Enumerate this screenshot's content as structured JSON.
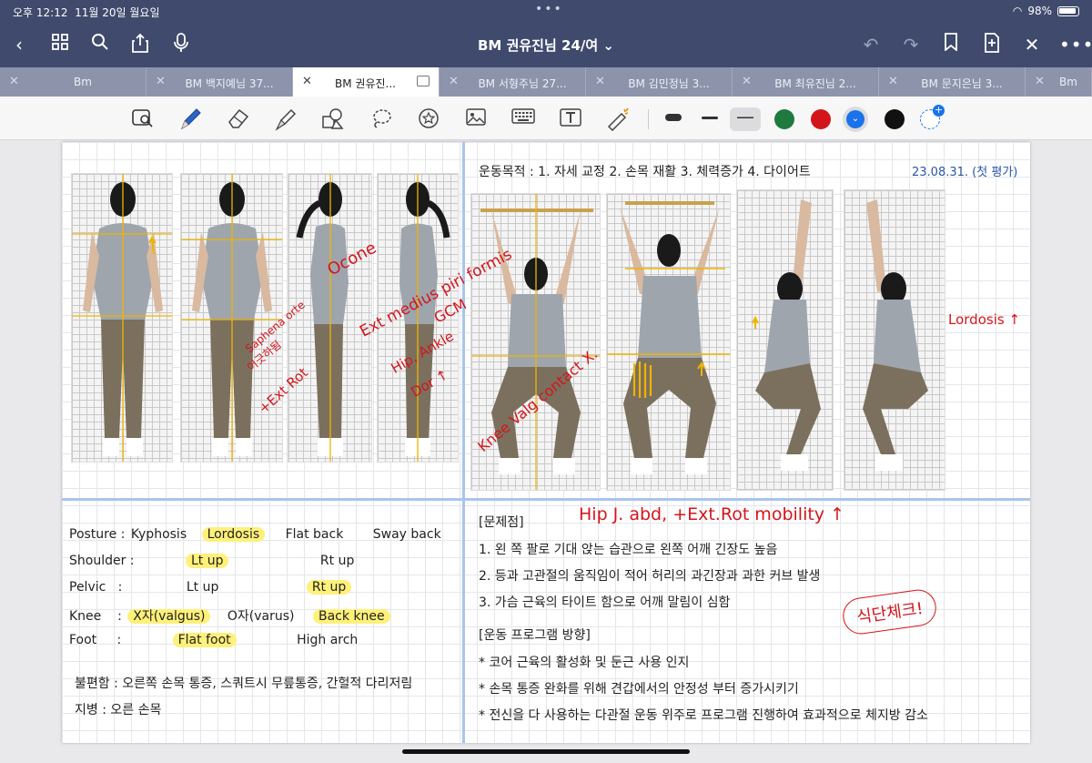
{
  "status_bar": {
    "time": "오후 12:12",
    "date": "11월 20일 월요일",
    "wifi_icon": "wifi-icon",
    "battery": "98%"
  },
  "nav": {
    "title": "BM 권유진님 24/여",
    "chevron": "⌄",
    "icons": [
      "back-icon",
      "grid-icon",
      "search-icon",
      "share-icon",
      "mic-icon",
      "undo-icon",
      "redo-icon",
      "bookmark-icon",
      "add-page-icon",
      "close-tools-icon",
      "more-icon"
    ]
  },
  "tabs": [
    {
      "label": "Bm",
      "active": false
    },
    {
      "label": "BM 백지예님 37...",
      "active": false
    },
    {
      "label": "BM 권유진...",
      "active": true
    },
    {
      "label": "BM 서형주님 27...",
      "active": false
    },
    {
      "label": "BM 김민정님 3...",
      "active": false
    },
    {
      "label": "BM 최유진님 2...",
      "active": false
    },
    {
      "label": "BM 문지은님 3...",
      "active": false
    },
    {
      "label": "Bm",
      "active": false
    }
  ],
  "toolbar": {
    "tools": [
      "lasso-zoom-icon",
      "pen-icon",
      "eraser-icon",
      "highlighter-icon",
      "shapes-icon",
      "lasso-icon",
      "sticker-icon",
      "image-icon",
      "keyboard-icon",
      "text-icon",
      "laser-icon"
    ],
    "colors": [
      "#1f7a3e",
      "#d3151b",
      "#1a73e8",
      "#111111"
    ],
    "selected_color": "#1a73e8"
  },
  "note": {
    "purpose": "운동목적 : 1. 자세 교정 2. 손목 재활 3. 체력증가 4. 다이어트",
    "date": "23.08.31. (첫 평가)",
    "annotations": {
      "ocone": "Ocone",
      "ext_med": "Ext medius piri formis",
      "gcm": "GCM",
      "hip_ankle": "Hip, Ankle",
      "dorsi": "Dor ↑",
      "saphena": "Saphena orte",
      "yeonghyang": "어긋하됨",
      "ext_rot": "+Ext Rot",
      "knee": "Knee Valg contact X.",
      "lordosis": "Lordosis ↑",
      "hip_mobility": "Hip J. abd, +Ext.Rot mobility ↑",
      "diet_check": "식단체크!"
    },
    "assessment": {
      "posture": {
        "label": "Posture",
        "items": [
          "Kyphosis",
          "Lordosis",
          "Flat back",
          "Sway back"
        ],
        "highlighted": "Lordosis"
      },
      "shoulder": {
        "label": "Shoulder",
        "items": [
          "Lt up",
          "Rt up"
        ],
        "highlighted": "Lt up"
      },
      "pelvic": {
        "label": "Pelvic",
        "items": [
          "Lt up",
          "Rt up"
        ],
        "highlighted": "Rt up"
      },
      "knee": {
        "label": "Knee",
        "items": [
          "X자(valgus)",
          "O자(varus)",
          "Back knee"
        ],
        "highlighted": [
          "X자(valgus)",
          "Back knee"
        ]
      },
      "foot": {
        "label": "Foot",
        "items": [
          "Flat foot",
          "High arch"
        ],
        "highlighted": "Flat foot"
      }
    },
    "discomfort": "불편함 : 오른쪽 손목 통증, 스쿼트시 무릎통증, 간헐적 다리저림",
    "condition": "지병 : 오른 손목",
    "problems_title": "[문제점]",
    "problems": [
      "1. 왼 쪽 팔로 기대 앉는 습관으로 왼쪽 어깨 긴장도 높음",
      "2. 등과 고관절의 움직임이 적어 허리의 과긴장과 과한 커브 발생",
      "3. 가슴 근육의 타이트 함으로 어깨 말림이 심함"
    ],
    "program_title": "[운동 프로그램 방향]",
    "program": [
      "* 코어 근육의 활성화 및 둔근 사용 인지",
      "* 손목 통증 완화를 위해 견갑에서의 안정성 부터 증가시키기",
      "* 전신을 다 사용하는 다관절 운동 위주로 프로그램 진행하여 효과적으로 체지방 감소"
    ]
  }
}
